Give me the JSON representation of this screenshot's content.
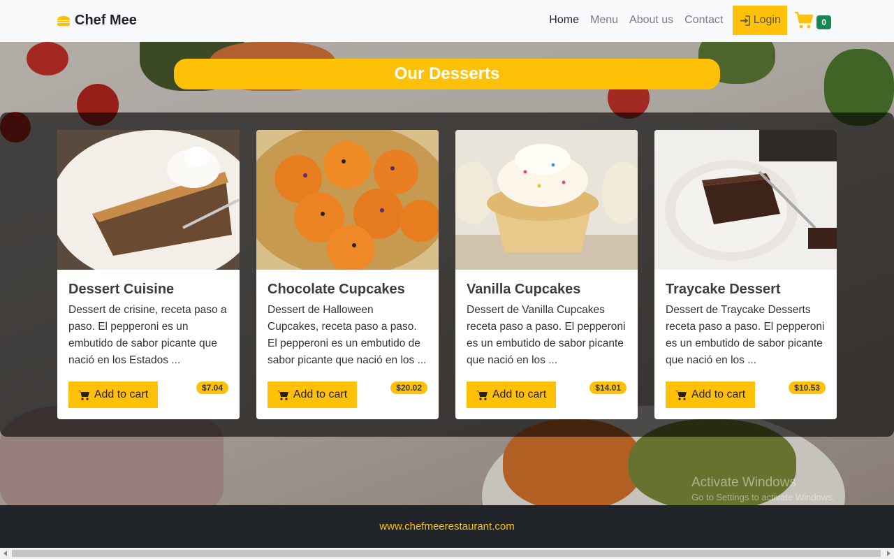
{
  "navbar": {
    "brand": "Chef Mee",
    "brand_icon": "burger-icon",
    "links": [
      "Home",
      "Menu",
      "About us",
      "Contact"
    ],
    "active_link": "Home",
    "login_label": "Login",
    "login_icon": "sign-in-icon",
    "cart_icon": "cart-icon",
    "cart_count": "0"
  },
  "hero": {
    "title": "Our Desserts"
  },
  "products": [
    {
      "title": "Dessert Cuisine",
      "description": "Dessert de crisine, receta paso a paso. El pepperoni es un embutido de sabor picante que nació en los Estados ...",
      "price": "$7.04",
      "button_label": "Add to cart"
    },
    {
      "title": "Chocolate Cupcakes",
      "description": "Dessert de Halloween Cupcakes, receta paso a paso. El pepperoni es un embutido de sabor picante que nació en los ...",
      "price": "$20.02",
      "button_label": "Add to cart"
    },
    {
      "title": "Vanilla Cupcakes",
      "description": "Dessert de Vanilla Cupcakes receta paso a paso. El pepperoni es un embutido de sabor picante que nació en los ...",
      "price": "$14.01",
      "button_label": "Add to cart"
    },
    {
      "title": "Traycake Dessert",
      "description": "Dessert de Traycake Desserts receta paso a paso. El pepperoni es un embutido de sabor picante que nació en los ...",
      "price": "$10.53",
      "button_label": "Add to cart"
    }
  ],
  "watermark": {
    "line1": "Activate Windows",
    "line2": "Go to Settings to activate Windows."
  },
  "footer": {
    "link": "www.chefmeerestaurant.com"
  },
  "colors": {
    "accent": "#ffc107",
    "badge": "#198754",
    "footer_bg": "#212529"
  }
}
